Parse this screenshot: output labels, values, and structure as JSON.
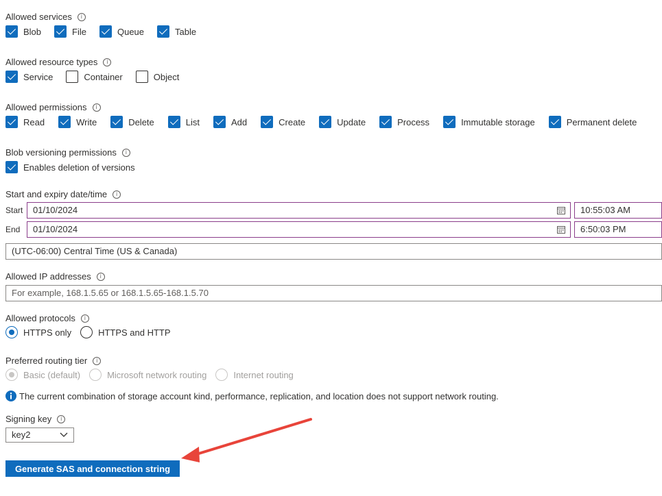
{
  "allowed_services": {
    "label": "Allowed services",
    "items": [
      {
        "label": "Blob",
        "checked": true
      },
      {
        "label": "File",
        "checked": true
      },
      {
        "label": "Queue",
        "checked": true
      },
      {
        "label": "Table",
        "checked": true
      }
    ]
  },
  "allowed_resource_types": {
    "label": "Allowed resource types",
    "items": [
      {
        "label": "Service",
        "checked": true
      },
      {
        "label": "Container",
        "checked": false
      },
      {
        "label": "Object",
        "checked": false
      }
    ]
  },
  "allowed_permissions": {
    "label": "Allowed permissions",
    "items": [
      {
        "label": "Read",
        "checked": true
      },
      {
        "label": "Write",
        "checked": true
      },
      {
        "label": "Delete",
        "checked": true
      },
      {
        "label": "List",
        "checked": true
      },
      {
        "label": "Add",
        "checked": true
      },
      {
        "label": "Create",
        "checked": true
      },
      {
        "label": "Update",
        "checked": true
      },
      {
        "label": "Process",
        "checked": true
      },
      {
        "label": "Immutable storage",
        "checked": true
      },
      {
        "label": "Permanent delete",
        "checked": true
      }
    ]
  },
  "blob_versioning": {
    "label": "Blob versioning permissions",
    "items": [
      {
        "label": "Enables deletion of versions",
        "checked": true
      }
    ]
  },
  "datetime": {
    "label": "Start and expiry date/time",
    "start_label": "Start",
    "start_date": "01/10/2024",
    "start_time": "10:55:03 AM",
    "end_label": "End",
    "end_date": "01/10/2024",
    "end_time": "6:50:03 PM",
    "timezone": "(UTC-06:00) Central Time (US & Canada)"
  },
  "ip": {
    "label": "Allowed IP addresses",
    "placeholder": "For example, 168.1.5.65 or 168.1.5.65-168.1.5.70"
  },
  "protocols": {
    "label": "Allowed protocols",
    "options": [
      {
        "label": "HTTPS only",
        "selected": true
      },
      {
        "label": "HTTPS and HTTP",
        "selected": false
      }
    ]
  },
  "routing": {
    "label": "Preferred routing tier",
    "options": [
      {
        "label": "Basic (default)",
        "selected": true
      },
      {
        "label": "Microsoft network routing",
        "selected": false
      },
      {
        "label": "Internet routing",
        "selected": false
      }
    ],
    "notice": "The current combination of storage account kind, performance, replication, and location does not support network routing."
  },
  "signing_key": {
    "label": "Signing key",
    "value": "key2"
  },
  "generate_button": "Generate SAS and connection string",
  "colors": {
    "accent": "#0f6cbd",
    "arrow": "#e8443a",
    "datetime_border": "#8a3d8a"
  },
  "info_icon": "i"
}
